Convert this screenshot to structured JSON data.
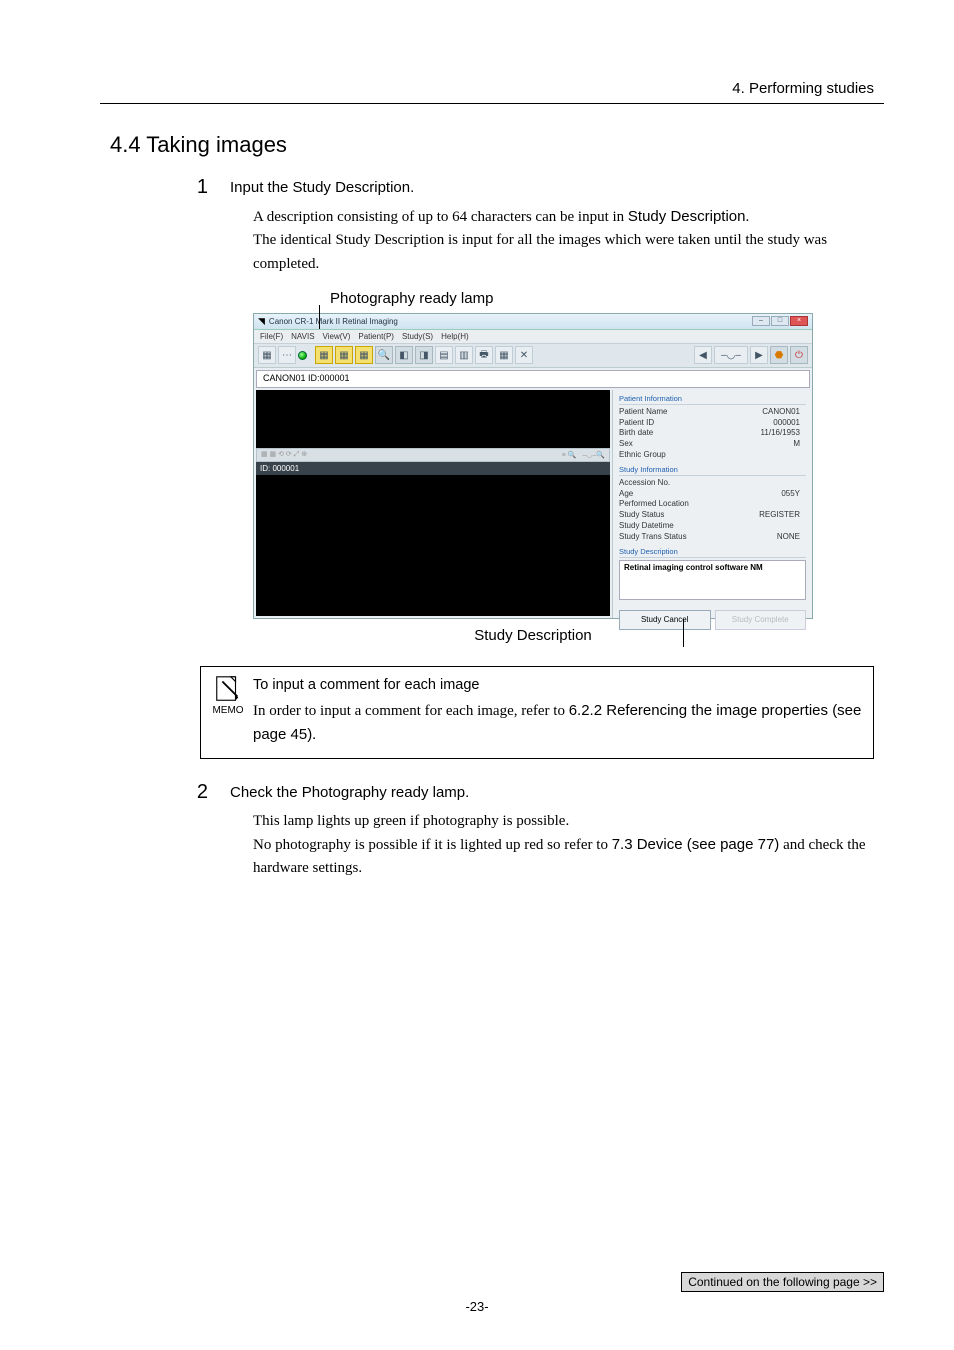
{
  "chapter_header": "4. Performing studies",
  "section_title": "4.4 Taking images",
  "step1": {
    "num": "1",
    "title": "Input the Study Description.",
    "body_a": "A description consisting of up to 64 characters can be input in ",
    "body_a_sans": "Study Description",
    "body_a_end": ".",
    "body_b": "The identical Study Description is input for all the images which were taken until the study was completed."
  },
  "caption_top": "Photography ready lamp",
  "app": {
    "title": "Canon CR-1 Mark II Retinal Imaging",
    "menus": [
      "File(F)",
      "NAVIS",
      "View(V)",
      "Patient(P)",
      "Study(S)",
      "Help(H)"
    ],
    "id_bar": "CANON01 ID:000001",
    "id_strip": "ID: 000001",
    "patient_info_title": "Patient Information",
    "patient": [
      {
        "label": "Patient Name",
        "val": "CANON01"
      },
      {
        "label": "Patient ID",
        "val": "000001"
      },
      {
        "label": "Birth date",
        "val": "11/16/1953"
      },
      {
        "label": "Sex",
        "val": "M"
      },
      {
        "label": "Ethnic Group",
        "val": ""
      }
    ],
    "study_info_title": "Study Information",
    "study": [
      {
        "label": "Accession No.",
        "val": ""
      },
      {
        "label": "Age",
        "val": "055Y"
      },
      {
        "label": "Performed Location",
        "val": ""
      },
      {
        "label": "Study Status",
        "val": "REGISTER"
      },
      {
        "label": "Study Datetime",
        "val": ""
      },
      {
        "label": "Study Trans Status",
        "val": "NONE"
      }
    ],
    "study_desc_title": "Study Description",
    "study_desc_value": "Retinal imaging control software NM",
    "btn_cancel": "Study Cancel",
    "btn_complete": "Study Complete"
  },
  "caption_bottom": "Study Description",
  "memo": {
    "icon_label": "MEMO",
    "title": "To input a comment for each image",
    "body_a": "In order to input a comment for each image, refer to ",
    "body_ref": "6.2.2 Referencing the image properties (see page 45)",
    "body_end": "."
  },
  "step2": {
    "num": "2",
    "title": "Check the Photography ready lamp.",
    "body_a": "This lamp lights up green if photography is possible.",
    "body_b_a": "No photography is possible if it is lighted up red so refer to ",
    "body_b_ref": "7.3 Device (see page 77)",
    "body_b_b": " and check the hardware settings."
  },
  "continued": "Continued on the following page >>",
  "page_number": "-23-"
}
